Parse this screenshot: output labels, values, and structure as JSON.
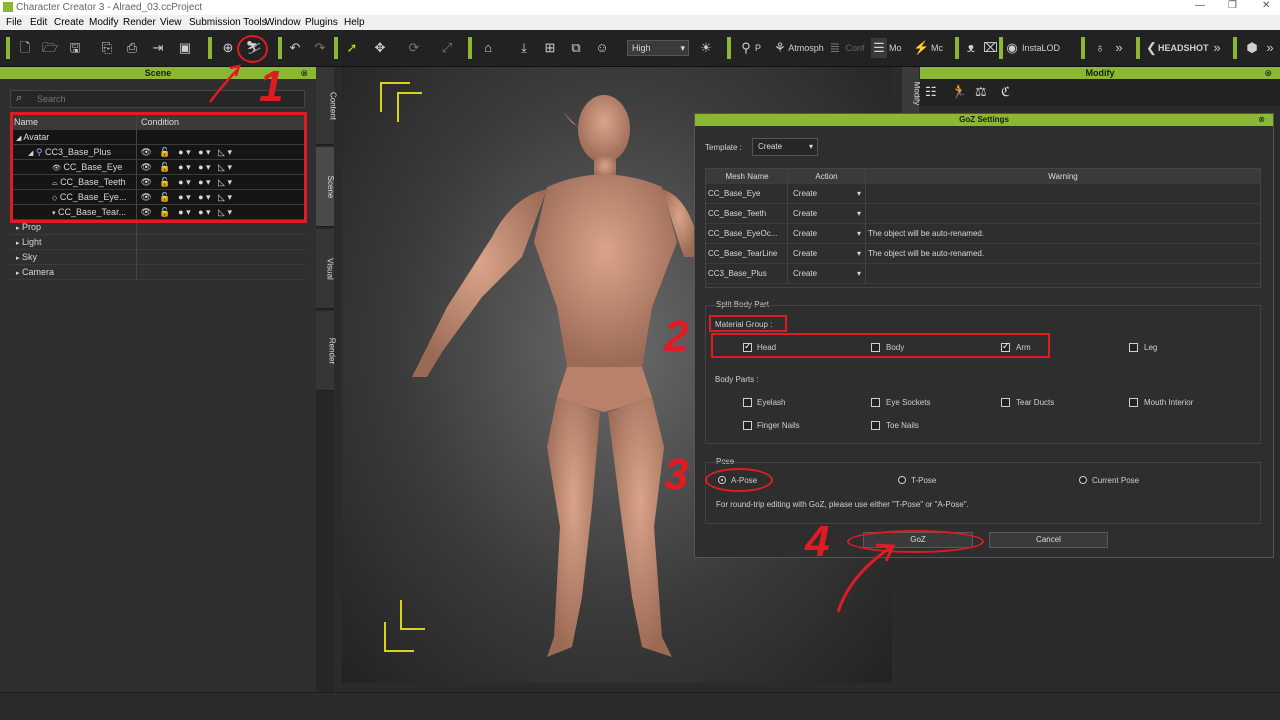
{
  "window": {
    "title": "Character Creator 3 - Alraed_03.ccProject"
  },
  "menu": [
    "File",
    "Edit",
    "Create",
    "Modify",
    "Render",
    "View",
    "Submission Tools",
    "Window",
    "Plugins",
    "Help"
  ],
  "toolbar": {
    "quality": "High",
    "p_label": "P",
    "atmosphere_label": "Atmosph",
    "conf_label": "Conf",
    "mo_label": "Mo",
    "mc_label": "Mc",
    "instalod_label": "InstaLOD",
    "headshot_label": "HEADSHOT",
    "more": "»"
  },
  "scene_panel": {
    "title": "Scene",
    "close": "⊗",
    "search_placeholder": "Search",
    "col_name": "Name",
    "col_condition": "Condition",
    "rows": [
      {
        "label": "Avatar",
        "toggle": "◢"
      },
      {
        "label": "CC3_Base_Plus",
        "toggle": "◢"
      },
      {
        "label": "CC_Base_Eye"
      },
      {
        "label": "CC_Base_Teeth"
      },
      {
        "label": "CC_Base_Eye..."
      },
      {
        "label": "CC_Base_Tear..."
      },
      {
        "label": "Prop",
        "toggle": "▸"
      },
      {
        "label": "Light",
        "toggle": "▸"
      },
      {
        "label": "Sky",
        "toggle": "▸"
      },
      {
        "label": "Camera",
        "toggle": "▸"
      }
    ]
  },
  "side_tabs": [
    "Content",
    "Scene",
    "Visual",
    "Render"
  ],
  "modify_panel": {
    "title": "Modify",
    "close": "⊗",
    "vtab": "Modify"
  },
  "goz_dialog": {
    "title": "GoZ Settings",
    "close": "⊗",
    "template_label": "Template :",
    "template_value": "Create",
    "columns": [
      "Mesh Name",
      "Action",
      "Warning"
    ],
    "rows": [
      {
        "mesh": "CC_Base_Eye",
        "action": "Create",
        "warning": ""
      },
      {
        "mesh": "CC_Base_Teeth",
        "action": "Create",
        "warning": ""
      },
      {
        "mesh": "CC_Base_EyeOc...",
        "action": "Create",
        "warning": "The object will be auto-renamed."
      },
      {
        "mesh": "CC_Base_TearLine",
        "action": "Create",
        "warning": "The object will be auto-renamed."
      },
      {
        "mesh": "CC3_Base_Plus",
        "action": "Create",
        "warning": ""
      }
    ],
    "split_body_part": "Split Body Part",
    "material_group_label": "Material Group :",
    "material_groups": [
      {
        "label": "Head",
        "checked": true
      },
      {
        "label": "Body",
        "checked": false
      },
      {
        "label": "Arm",
        "checked": true
      },
      {
        "label": "Leg",
        "checked": false
      }
    ],
    "body_parts_label": "Body Parts :",
    "body_parts": [
      {
        "label": "Eyelash",
        "checked": false
      },
      {
        "label": "Eye Sockets",
        "checked": false
      },
      {
        "label": "Tear Ducts",
        "checked": false
      },
      {
        "label": "Mouth Interior",
        "checked": false
      },
      {
        "label": "Finger Nails",
        "checked": false
      },
      {
        "label": "Toe Nails",
        "checked": false
      }
    ],
    "pose_label": "Pose",
    "poses": [
      {
        "label": "A-Pose",
        "selected": true
      },
      {
        "label": "T-Pose",
        "selected": false
      },
      {
        "label": "Current Pose",
        "selected": false
      }
    ],
    "pose_note": "For round-trip editing with GoZ, please use either \"T-Pose\" or \"A-Pose\".",
    "goz_button": "GoZ",
    "cancel_button": "Cancel"
  },
  "annotations": [
    "1",
    "2",
    "3",
    "4"
  ],
  "colors": {
    "accent": "#8ab832",
    "annotation": "#e01b24",
    "frame": "#d7d21a"
  }
}
